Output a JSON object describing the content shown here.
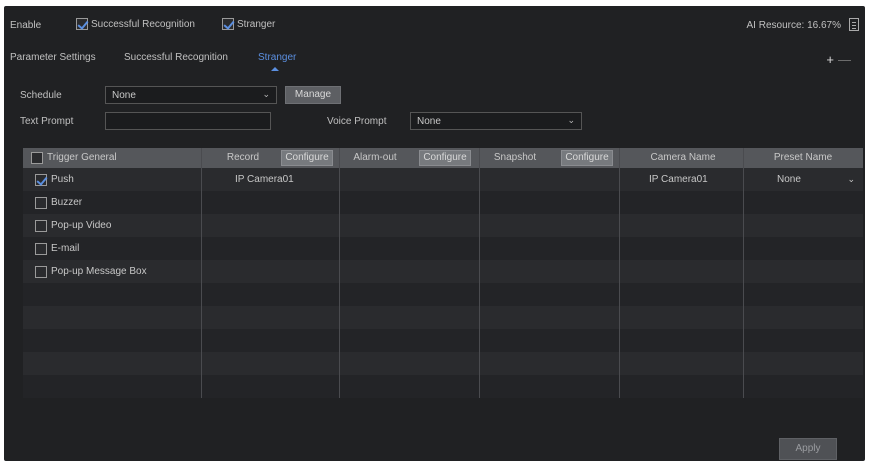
{
  "top": {
    "enable_label": "Enable",
    "successful_recognition_label": "Successful Recognition",
    "successful_recognition_checked": true,
    "stranger_label": "Stranger",
    "stranger_checked": true,
    "ai_resource": "AI Resource: 16.67%"
  },
  "tabs": [
    {
      "label": "Parameter Settings",
      "active": false
    },
    {
      "label": "Successful Recognition",
      "active": false
    },
    {
      "label": "Stranger",
      "active": true
    }
  ],
  "controls": {
    "plus": "+",
    "minus": "—",
    "schedule_label": "Schedule",
    "schedule_value": "None",
    "manage_label": "Manage",
    "text_prompt_label": "Text Prompt",
    "text_prompt_value": "",
    "voice_prompt_label": "Voice Prompt",
    "voice_prompt_value": "None"
  },
  "table": {
    "headers": {
      "trigger_general": "Trigger General",
      "record": "Record",
      "alarm_out": "Alarm-out",
      "snapshot": "Snapshot",
      "configure": "Configure",
      "camera_name": "Camera Name",
      "preset_name": "Preset Name"
    },
    "triggers": [
      {
        "label": "Push",
        "checked": true
      },
      {
        "label": "Buzzer",
        "checked": false
      },
      {
        "label": "Pop-up Video",
        "checked": false
      },
      {
        "label": "E-mail",
        "checked": false
      },
      {
        "label": "Pop-up Message Box",
        "checked": false
      }
    ],
    "record_cell": "IP Camera01",
    "camera_name_cell": "IP Camera01",
    "preset_name_cell": "None"
  },
  "footer": {
    "apply_label": "Apply"
  },
  "colors": {
    "accent": "#5b8fe0",
    "background": "#202123",
    "header": "#55575b"
  }
}
